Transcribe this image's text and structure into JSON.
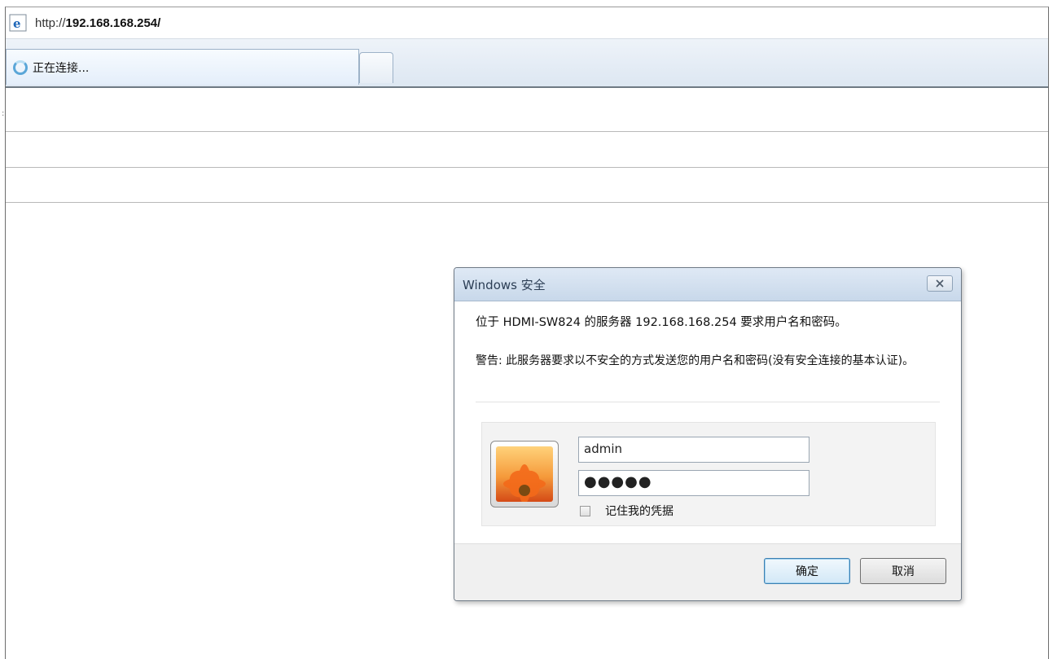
{
  "browser": {
    "address": {
      "prefix": "http://",
      "host": "192.168.168.254/"
    },
    "tab": {
      "label": "正在连接..."
    }
  },
  "dialog": {
    "title": "Windows 安全",
    "message": "位于 HDMI-SW824 的服务器 192.168.168.254 要求用户名和密码。",
    "warning": "警告: 此服务器要求以不安全的方式发送您的用户名和密码(没有安全连接的基本认证)。",
    "username_value": "admin",
    "password_masked": "●●●●●",
    "remember_label": "记住我的凭据",
    "remember_checked": false,
    "ok_label": "确定",
    "cancel_label": "取消"
  }
}
